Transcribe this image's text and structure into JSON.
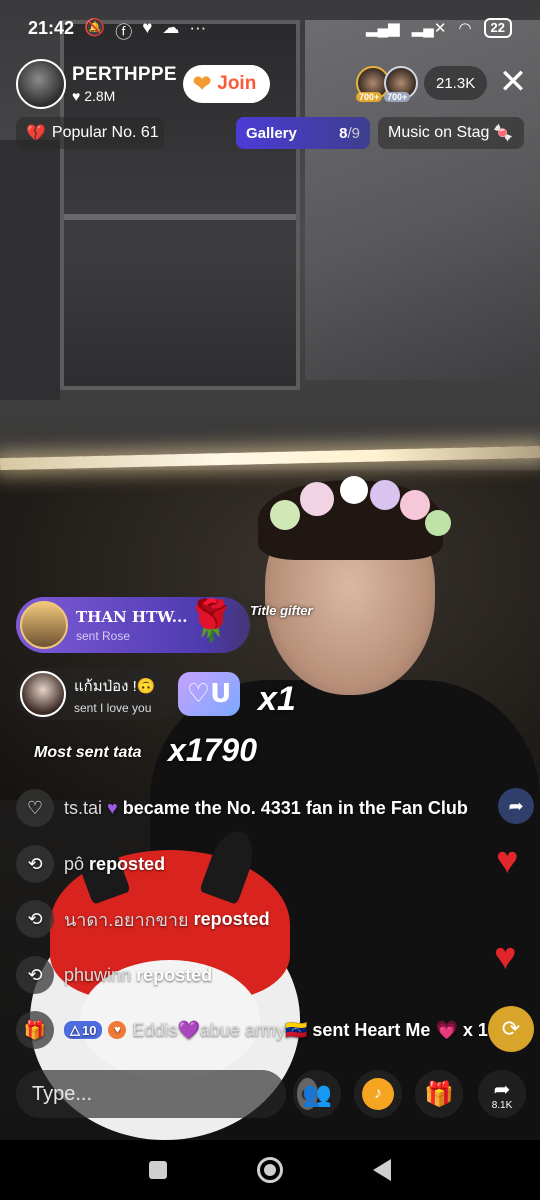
{
  "status": {
    "time": "21:42",
    "battery": "22"
  },
  "host": {
    "name": "PERTHPPE",
    "likes": "2.8M",
    "join_label": "Join"
  },
  "viewers": {
    "badge1": "700+",
    "badge2": "700+",
    "count": "21.3K"
  },
  "pills": {
    "popular_label": "Popular No.",
    "popular_rank": "61",
    "gallery_label": "Gallery",
    "gallery_count": "8",
    "gallery_total": "/9",
    "music_label": "Music on Stag"
  },
  "gifts": {
    "banner1_name": "THAN HTW...",
    "banner1_sub": "sent Rose",
    "title_gifter": "Title gifter",
    "banner2_name": "แก้มป่อง !🙃",
    "banner2_sub": "sent I love you",
    "combo1": "x1",
    "most_sent": "Most sent tata",
    "combo2": "x1790"
  },
  "chat": [
    {
      "user": "ts.tai",
      "action": "became the No. 4331 fan in the Fan Club",
      "icon": "heart-outline-icon"
    },
    {
      "user": "pô",
      "action": "reposted",
      "icon": "repost-icon"
    },
    {
      "user": "นาดา.อยากขาย",
      "action": "reposted",
      "icon": "repost-icon"
    },
    {
      "user": "phuwinn",
      "action": "reposted",
      "icon": "repost-icon"
    },
    {
      "level": "10",
      "user": "Eddis💜abue army🇻🇪",
      "action": "sent Heart Me",
      "suffix": "x 1",
      "icon": "gift-box-icon"
    }
  ],
  "bottom": {
    "input_placeholder": "Type...",
    "share_count": "8.1K"
  },
  "colors": {
    "join_text": "#fb5a37",
    "gallery_pill": "#4c3bd6",
    "gift_banner": "#7d5bd8",
    "heart": "#e0262b"
  }
}
